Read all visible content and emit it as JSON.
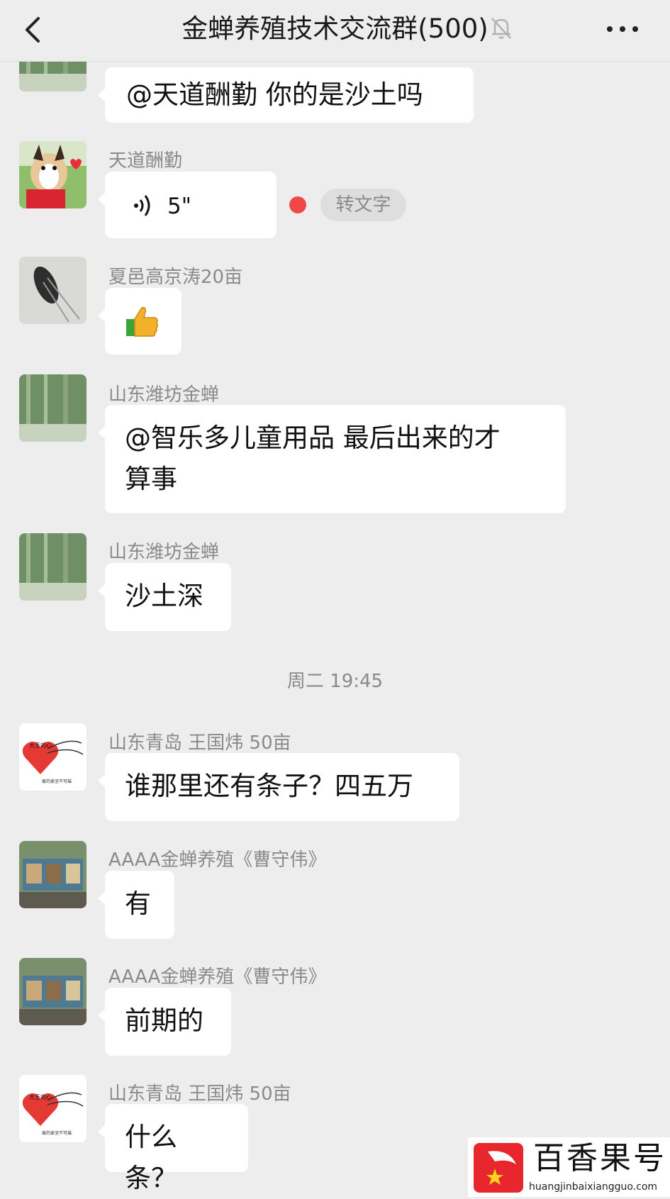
{
  "header": {
    "title": "金蝉养殖技术交流群(500)"
  },
  "colors": {
    "bubble": "#ffffff",
    "background": "#ededed",
    "unread_dot": "#f04848"
  },
  "messages": [
    {
      "text": "@天道酬勤  你的是沙土吗"
    },
    {
      "sender": "天道酬勤",
      "voice_duration": "5\"",
      "to_text_label": "转文字"
    },
    {
      "sender": "夏邑高京涛20亩",
      "emoji": "thumbs-up"
    },
    {
      "sender": "山东潍坊金蝉",
      "text_line1": "@智乐多儿童用品  最后出来的才",
      "text_line2": "算事"
    },
    {
      "sender": "山东潍坊金蝉",
      "text": "沙土深"
    },
    {
      "sender": "山东青岛 王国炜 50亩",
      "text": "谁那里还有条子？四五万"
    },
    {
      "sender": "AAAA金蝉养殖《曹守伟》",
      "text": "有"
    },
    {
      "sender": "AAAA金蝉养殖《曹守伟》",
      "text": "前期的"
    },
    {
      "sender": "山东青岛 王国炜 50亩",
      "text": "什么条？"
    }
  ],
  "timestamp": "周二 19:45",
  "avatar_texts": {
    "heart_title": "大王的心",
    "heart_caption": "痕的爱坚不可摧"
  },
  "watermark": {
    "name": "百香果号",
    "url": "huangjinbaixiangguo.com"
  }
}
